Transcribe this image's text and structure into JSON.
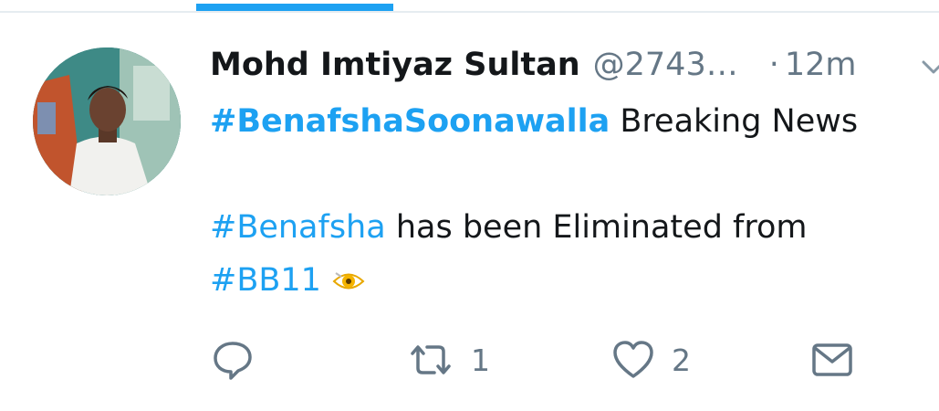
{
  "tweet": {
    "author_name": "Mohd Imtiyaz Sultan",
    "handle": "@2743…",
    "separator": "·",
    "time": "12m",
    "text": {
      "line1_hashtag": "#BenafshaSoonawalla",
      "line1_text": "Breaking News",
      "line2_hashtag": "#Benafsha",
      "line2_text": "has been Eliminated from",
      "line3_hashtag": "#BB11"
    }
  },
  "actions": {
    "retweet_count": "1",
    "like_count": "2"
  },
  "colors": {
    "accent": "#1da1f2",
    "muted": "#657786",
    "text": "#14171a"
  },
  "icons": {
    "reply": "reply-icon",
    "retweet": "retweet-icon",
    "like": "heart-icon",
    "dm": "envelope-icon",
    "caret": "chevron-down-icon",
    "emoji": "eye-in-speech-bubble-icon"
  }
}
